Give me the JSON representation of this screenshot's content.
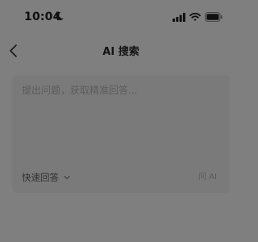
{
  "status_bar": {
    "time": "10:04",
    "icons": [
      "moon-icon",
      "signal-icon",
      "wifi-icon",
      "battery-icon"
    ]
  },
  "nav": {
    "title": "AI 搜索",
    "back_icon": "chevron-left-icon"
  },
  "search": {
    "placeholder": "提出问题，获取精准回答...",
    "value": "",
    "mode_label": "快速回答",
    "mode_icon": "chevron-down-icon",
    "submit_label": "问 AI"
  },
  "colors": {
    "overlay_background": "#7f7f7f",
    "card_background": "#7a7a7a",
    "text_primary": "#141414",
    "text_placeholder": "#5c5c5c",
    "submit_text": "#5a5a5a"
  }
}
